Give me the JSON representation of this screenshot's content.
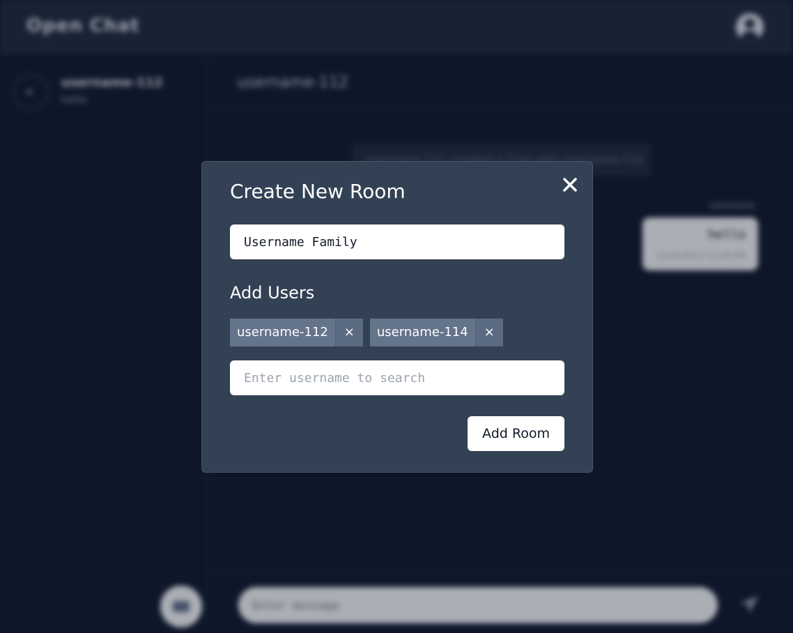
{
  "app": {
    "brand": "Open Chat"
  },
  "sidebar": {
    "rooms": [
      {
        "name": "username-112",
        "last_message": "hello"
      }
    ]
  },
  "chat": {
    "title": "username-112",
    "system_message": "username-112 created a Chat with username-112",
    "messages": [
      {
        "sender": "username",
        "text": "hello",
        "time": "12/31/2023 12:00 PM"
      }
    ],
    "composer_placeholder": "Enter message"
  },
  "modal": {
    "title": "Create New Room",
    "room_name_value": "Username Family",
    "add_users_label": "Add Users",
    "selected_users": [
      {
        "label": "username-112",
        "remove_glyph": "×"
      },
      {
        "label": "username-114",
        "remove_glyph": "×"
      }
    ],
    "search_placeholder": "Enter username to search",
    "search_value": "",
    "submit_label": "Add Room"
  },
  "colors": {
    "page_bg": "#0f172a",
    "topbar_bg": "#1e293b",
    "modal_bg": "#334155",
    "chip_bg": "#64748b"
  },
  "icons": {
    "close": "close-icon",
    "account": "user-avatar-icon",
    "send": "send-icon",
    "new_room": "chat-icon"
  }
}
